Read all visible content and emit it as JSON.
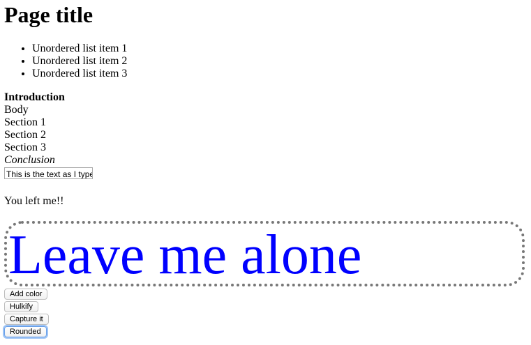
{
  "header": {
    "title": "Page title"
  },
  "list": {
    "items": [
      "Unordered list item 1",
      "Unordered list item 2",
      "Unordered list item 3"
    ]
  },
  "outline": {
    "introduction": "Introduction",
    "body": "Body",
    "section1": "Section 1",
    "section2": "Section 2",
    "section3": "Section 3",
    "conclusion": "Conclusion"
  },
  "input": {
    "value": "This is the text as I type"
  },
  "message": {
    "left": "You left me!!"
  },
  "alone": {
    "text": "Leave me alone",
    "text_color": "#0000ff",
    "border_color": "#777777"
  },
  "buttons": {
    "add_color": "Add color",
    "hulkify": "Hulkify",
    "capture": "Capture it",
    "rounded": "Rounded"
  }
}
